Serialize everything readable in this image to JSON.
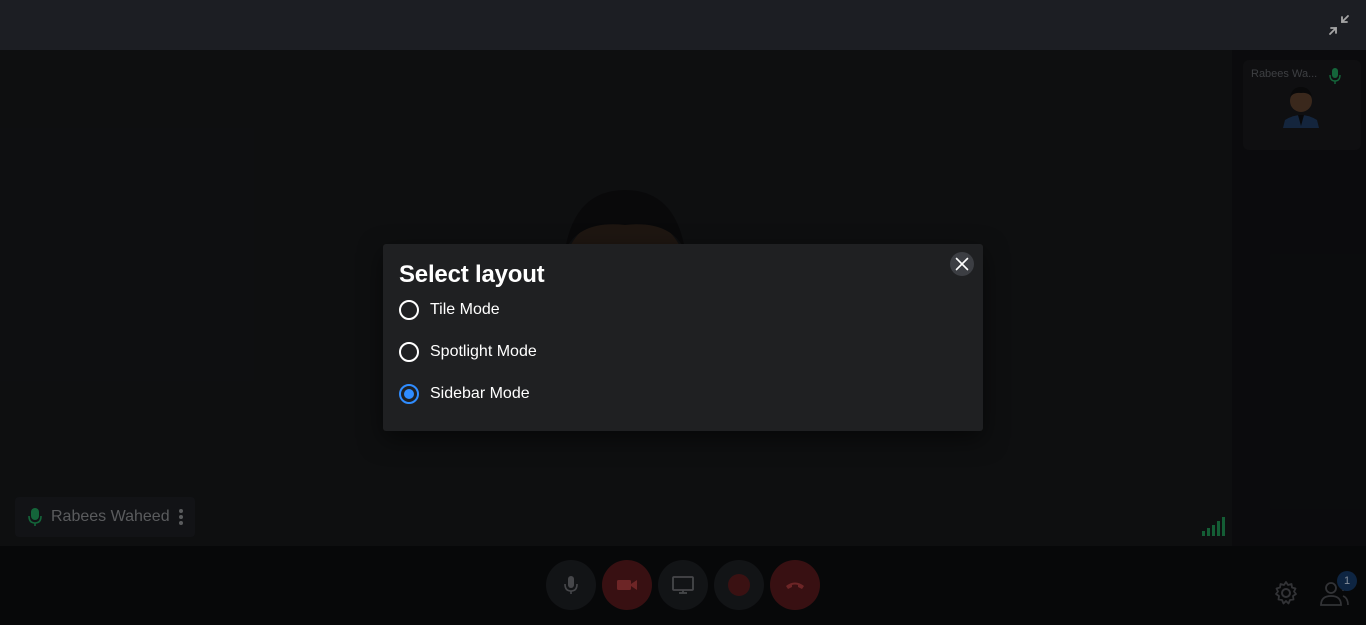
{
  "colors": {
    "accent": "#2f8cff",
    "mic_active": "#1f9c5a",
    "end_call": "#d32b2b",
    "muted_video": "#d32b2b"
  },
  "toolbar": {
    "fullscreen_icon": "exit-fullscreen-icon"
  },
  "stage": {
    "participant_name": "Rabees Waheed"
  },
  "sidebar": {
    "tile_name": "Rabees Wa..."
  },
  "controls": {
    "participants_count": "1",
    "buttons": [
      "microphone-icon",
      "video-off-icon",
      "screen-share-icon",
      "record-icon",
      "end-call-icon"
    ]
  },
  "modal": {
    "title": "Select layout",
    "options": [
      {
        "label": "Tile Mode",
        "selected": false
      },
      {
        "label": "Spotlight Mode",
        "selected": false
      },
      {
        "label": "Sidebar Mode",
        "selected": true
      }
    ]
  }
}
